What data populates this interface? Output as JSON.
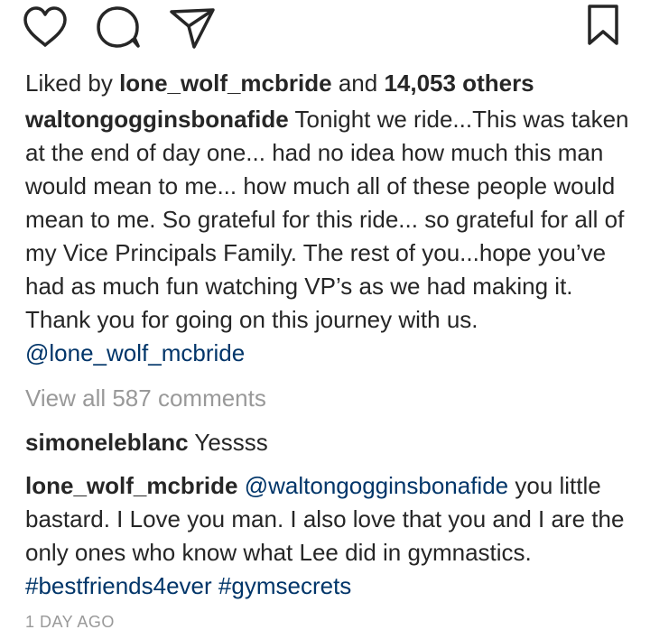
{
  "actions": {
    "like_icon": "heart-outline",
    "comment_icon": "speech-bubble",
    "share_icon": "paper-plane",
    "save_icon": "bookmark"
  },
  "likes": {
    "prefix": "Liked by",
    "user": "lone_wolf_mcbride",
    "conjunction": "and",
    "others": "14,053 others"
  },
  "caption": {
    "username": "waltongogginsbonafide",
    "text": "Tonight we ride...This was taken at the end of day one... had no idea how much this man would mean to me... how much all of these people would mean to me. So grateful for this ride... so grateful for all of my Vice Principals Family. The rest of you...hope you’ve had as much fun watching VP’s as we had making it.  Thank you for going on this journey with us.",
    "mention": "@lone_wolf_mcbride"
  },
  "view_all_comments": "View all 587 comments",
  "comments": [
    {
      "username": "simoneleblanc",
      "text": "Yessss"
    },
    {
      "username": "lone_wolf_mcbride",
      "mention": "@waltongogginsbonafide",
      "text": "you little bastard. I Love you man. I also love that you and I are the only ones who know what Lee did in gymnastics.",
      "hashtag1": "#bestfriends4ever",
      "hashtag2": "#gymsecrets"
    }
  ],
  "timestamp": "1 DAY AGO",
  "colors": {
    "text": "#262626",
    "link": "#003569",
    "muted": "#999999"
  }
}
